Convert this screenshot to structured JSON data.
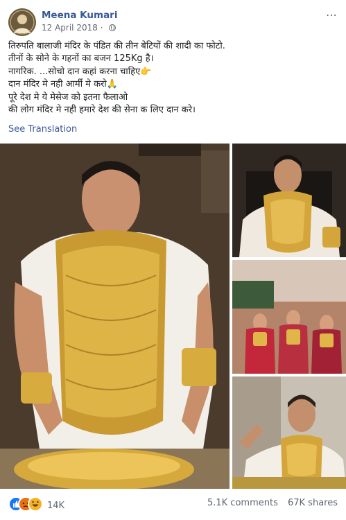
{
  "post": {
    "author": "Meena Kumari",
    "date": "12 April 2018",
    "separator": "·",
    "more_icon": "⋯",
    "text_lines": [
      "तिरुपति बालाजी मंदिर के पंडित की तीन बेटियों की शादी का फोटो.",
      "तीनों के सोने के गहनों का बजन 125Kg है।",
      "नागरिक. ...सोचो दान कहां करना चाहिए👉",
      "दान मंदिर मे नही आर्मी मे करो🙏",
      "पूरे देश मे ये मेसेज को इतना फैलाओ",
      "की लोग मंदिर मे नही हमारे देश की सेना क लिए दान करे।"
    ],
    "see_translation": "See Translation",
    "reactions": {
      "count": "14K",
      "icons": [
        "like-icon",
        "angry-icon",
        "haha-icon"
      ]
    },
    "comments": "5.1K comments",
    "shares": "67K shares"
  },
  "photos": [
    {
      "description": "man wearing heavy gold chains seated at a table"
    },
    {
      "description": "man wearing heavy gold chains in a chair"
    },
    {
      "description": "three brides in red and gold attire"
    },
    {
      "description": "man in gold chains gesturing with hand"
    }
  ],
  "colors": {
    "link": "#385898",
    "text": "#1c1e21",
    "muted": "#606770",
    "like": "#1877f2",
    "gold": "#d4a53a"
  }
}
